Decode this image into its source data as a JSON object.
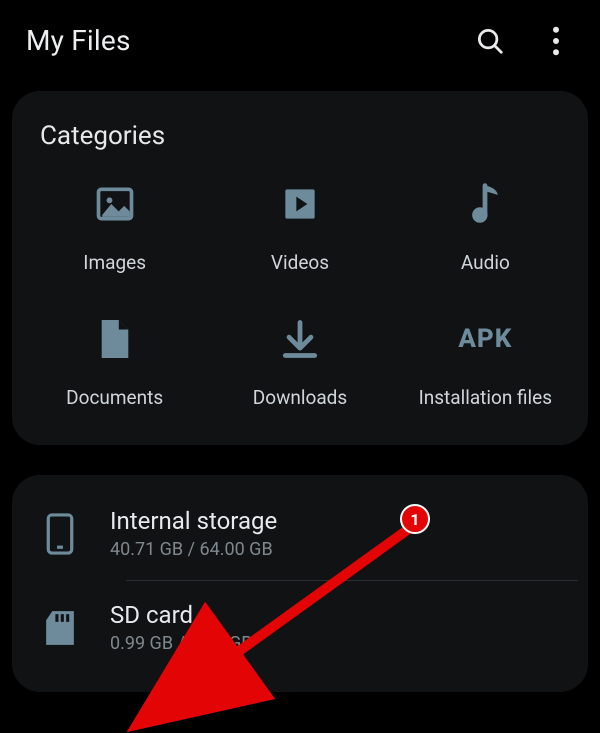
{
  "header": {
    "title": "My Files"
  },
  "categories": {
    "heading": "Categories",
    "items": [
      {
        "label": "Images"
      },
      {
        "label": "Videos"
      },
      {
        "label": "Audio"
      },
      {
        "label": "Documents"
      },
      {
        "label": "Downloads"
      },
      {
        "label": "Installation files",
        "apk": "APK"
      }
    ]
  },
  "storage": {
    "internal": {
      "title": "Internal storage",
      "sub": "40.71 GB / 64.00 GB"
    },
    "sdcard": {
      "title": "SD card",
      "sub": "0.99 GB / 1.86 GB"
    }
  },
  "annotation": {
    "badge": "1"
  }
}
